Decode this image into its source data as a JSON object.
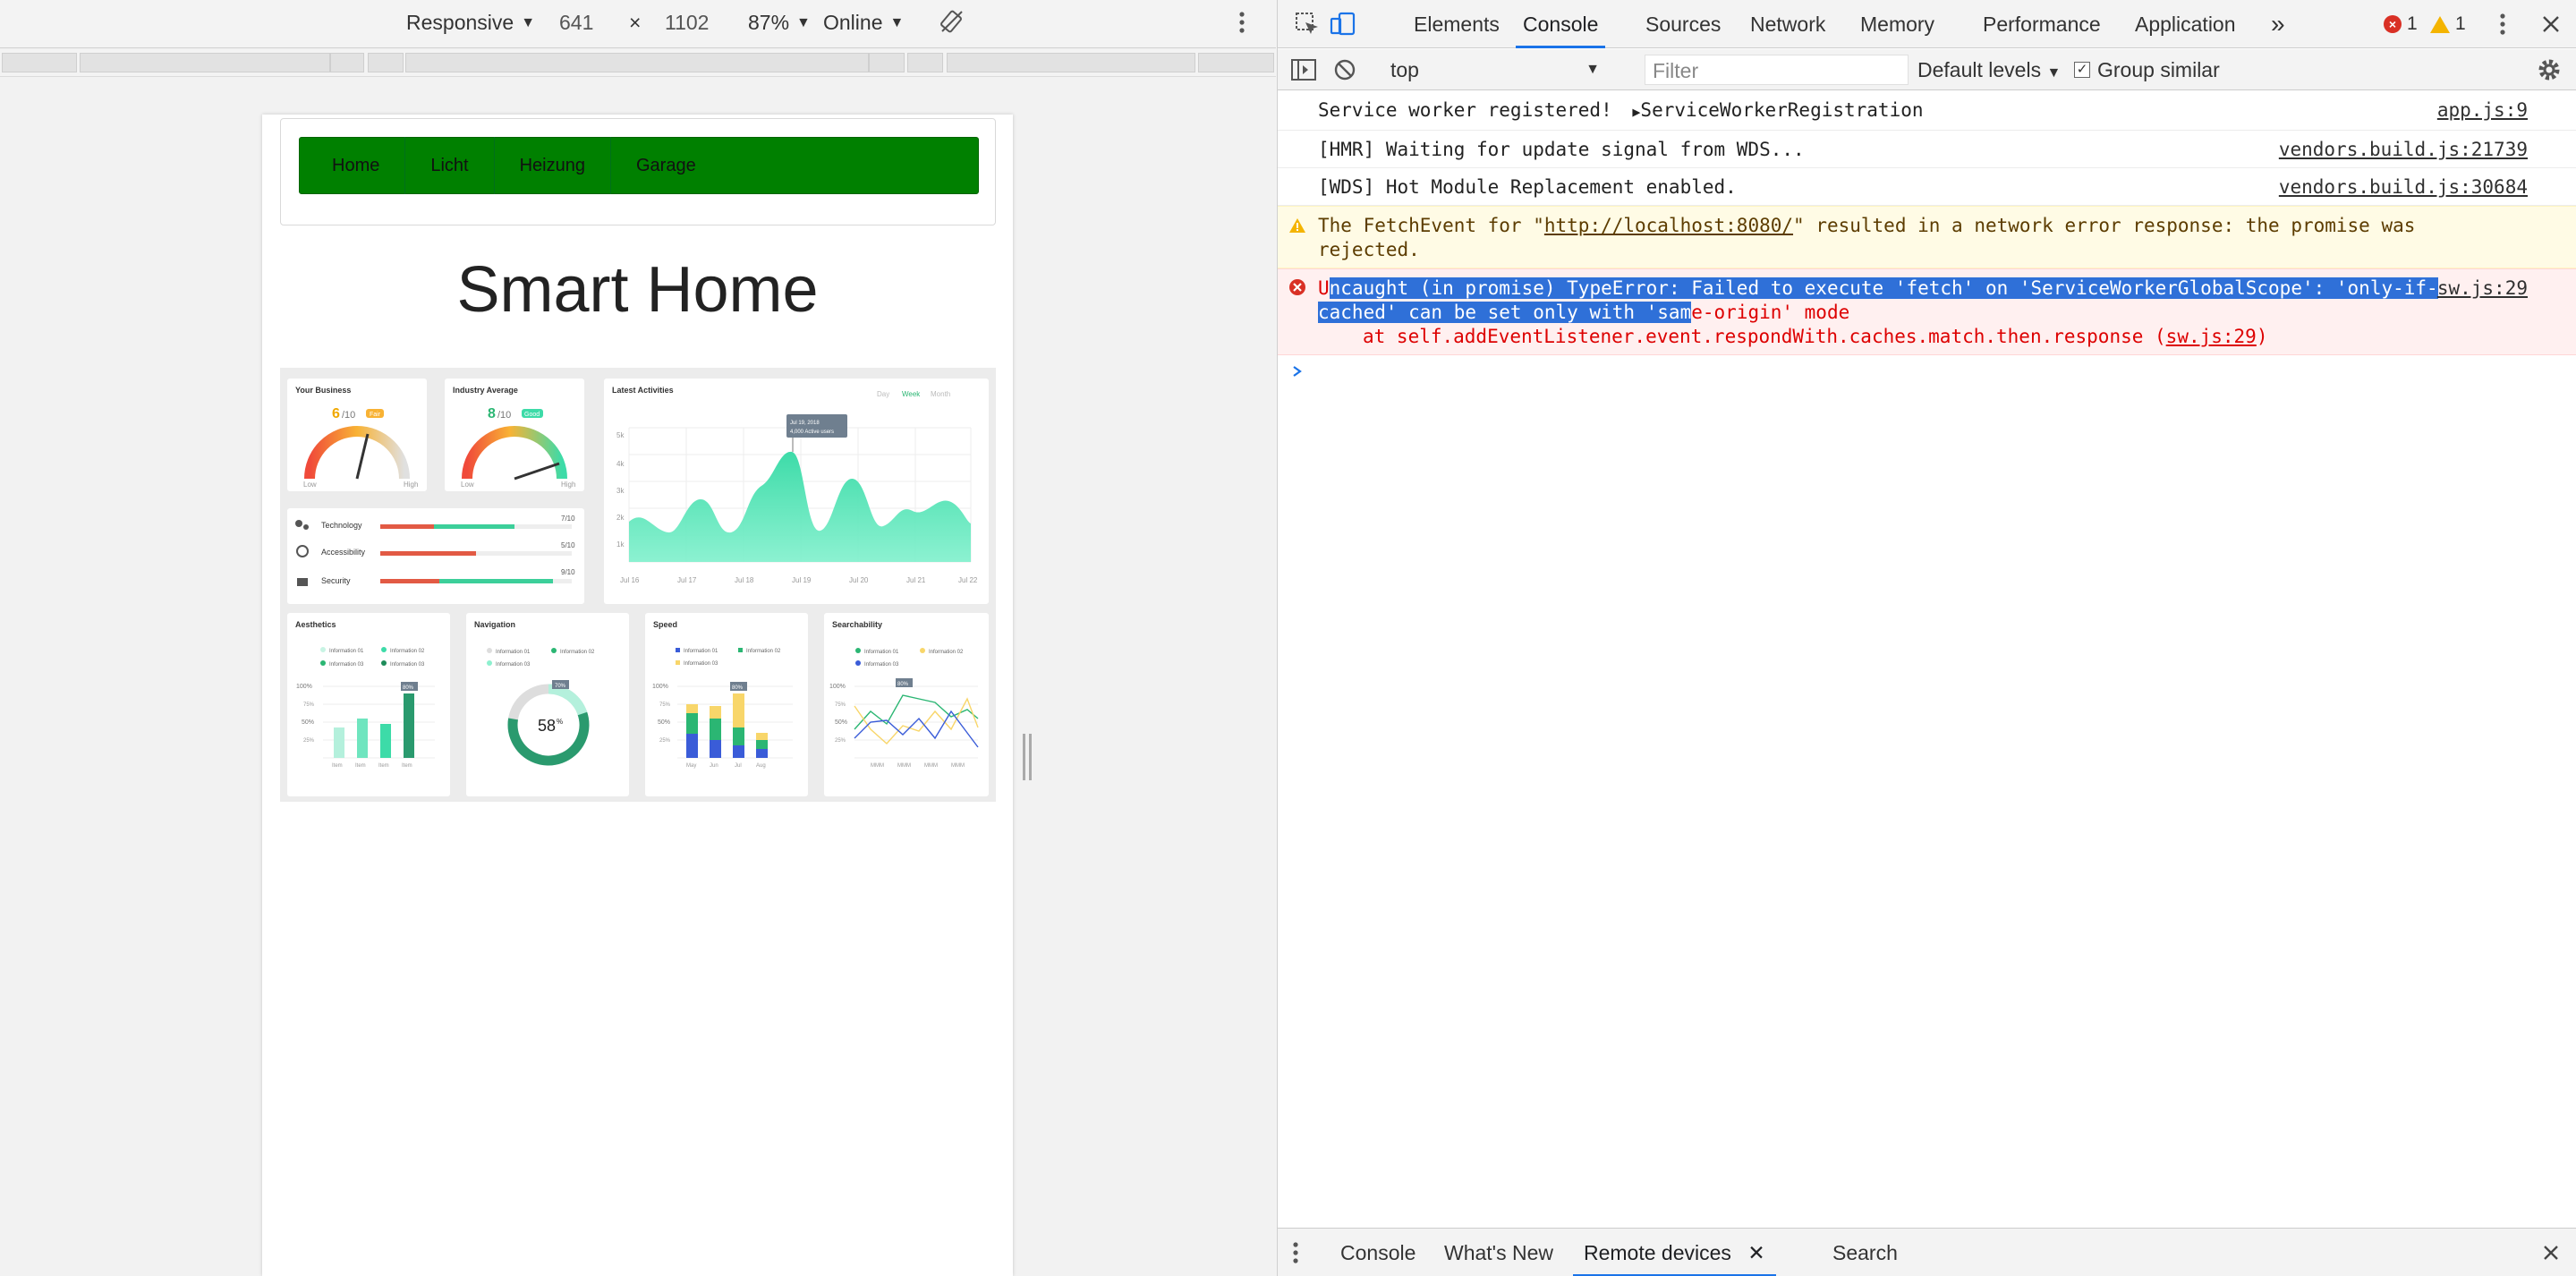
{
  "emulation": {
    "device_mode": "Responsive",
    "width": "641",
    "times": "×",
    "height": "1102",
    "zoom": "87%",
    "network": "Online"
  },
  "app": {
    "nav_links": [
      "Home",
      "Licht",
      "Heizung",
      "Garage"
    ],
    "title": "Smart Home"
  },
  "dashboard": {
    "your_business": {
      "title": "Your Business",
      "score": "6",
      "score_suffix": "/10",
      "badge": "Fair",
      "low": "Low",
      "high": "High",
      "value": 0.6
    },
    "industry_average": {
      "title": "Industry Average",
      "score": "8",
      "score_suffix": "/10",
      "badge": "Good",
      "low": "Low",
      "high": "High",
      "value": 0.8
    },
    "latest_activities": {
      "title": "Latest Activities",
      "tabs": [
        "Day",
        "Week",
        "Month"
      ],
      "tooltip_line1": "Jul 19, 2018",
      "tooltip_line2": "4,000 Active users",
      "y_ticks": [
        "5k",
        "4k",
        "3k",
        "2k",
        "1k"
      ],
      "x_ticks": [
        "Jul 16",
        "Jul 17",
        "Jul 18",
        "Jul 19",
        "Jul 20",
        "Jul 21",
        "Jul 22"
      ]
    },
    "ratings": [
      {
        "label": "Technology",
        "value": "7/10"
      },
      {
        "label": "Accessibility",
        "value": "5/10"
      },
      {
        "label": "Security",
        "value": "9/10"
      }
    ],
    "aesthetics": {
      "title": "Aesthetics",
      "legend": [
        "Information 01",
        "Information 02",
        "Information 03",
        "Information 03"
      ],
      "callout": "80%",
      "y_ticks": [
        "100%",
        "75%",
        "50%",
        "25%"
      ],
      "x_ticks": [
        "Item",
        "Item",
        "Item",
        "Item"
      ]
    },
    "navigation": {
      "title": "Navigation",
      "legend": [
        "Information 01",
        "Information 02",
        "Information 03"
      ],
      "callout": "70%",
      "center": "58",
      "center_suffix": "%"
    },
    "speed": {
      "title": "Speed",
      "legend": [
        "Information 01",
        "Information 02",
        "Information 03"
      ],
      "callout": "80%",
      "y_ticks": [
        "100%",
        "75%",
        "50%",
        "25%"
      ],
      "x_ticks": [
        "May",
        "Jun",
        "Jul",
        "Aug"
      ]
    },
    "searchability": {
      "title": "Searchability",
      "legend": [
        "Information 01",
        "Information 02",
        "Information 03"
      ],
      "callout": "80%",
      "y_ticks": [
        "100%",
        "75%",
        "50%",
        "25%"
      ],
      "x_ticks": [
        "MMM",
        "MMM",
        "MMM",
        "MMM"
      ]
    }
  },
  "devtools": {
    "tabs": [
      "Elements",
      "Console",
      "Sources",
      "Network",
      "Memory",
      "Performance",
      "Application"
    ],
    "more": "»",
    "error_count": "1",
    "warning_count": "1",
    "context": "top",
    "filter_placeholder": "Filter",
    "levels": "Default levels",
    "group_similar": "Group similar",
    "messages": [
      {
        "text": "Service worker registered!",
        "extra": "ServiceWorkerRegistration",
        "source": "app.js:9"
      },
      {
        "text": "[HMR] Waiting for update signal from WDS...",
        "source": "vendors.build.js:21739"
      },
      {
        "text": "[WDS] Hot Module Replacement enabled.",
        "source": "vendors.build.js:30684"
      }
    ],
    "warning": {
      "pre": "The FetchEvent for \"",
      "url": "http://localhost:8080/",
      "post": "\" resulted in a network error response: the promise was rejected."
    },
    "error": {
      "lead": "U",
      "highlight1": "ncaught (in promise) TypeError: Failed to execute 'fetch' on 'ServiceWorkerGlobalScope': 'only-if-",
      "highlight2": "cached' can be set only with 'sam",
      "rest2": "e-origin' mode",
      "trace_pre": "at self.addEventListener.event.respondWith.caches.match.then.response (",
      "trace_link": "sw.js:29",
      "trace_post": ")",
      "source": "sw.js:29"
    },
    "drawer_tabs": [
      "Console",
      "What's New",
      "Remote devices",
      "Search"
    ]
  },
  "colors": {
    "navbar": "#008000",
    "accent": "#1a73e8",
    "teal": "#3ddba8"
  }
}
